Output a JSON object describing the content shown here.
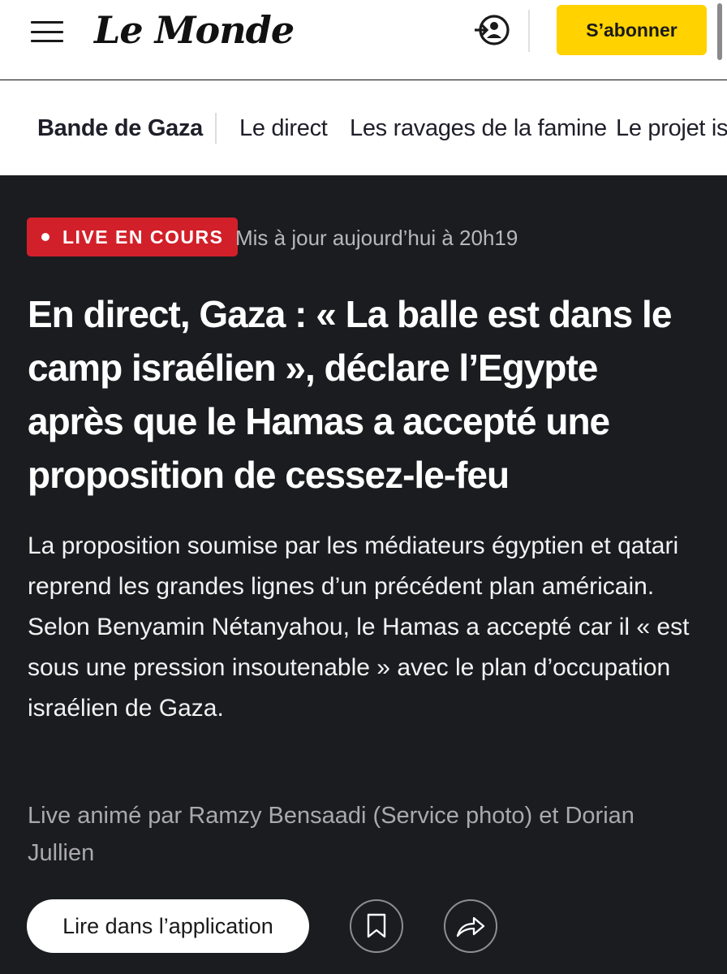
{
  "header": {
    "logo": "Le Monde",
    "subscribe_label": "S’abonner",
    "icons": [
      "menu-icon",
      "account-icon"
    ],
    "colors": {
      "subscribe_bg": "#ffd200"
    }
  },
  "subnav": {
    "section": "Bande de Gaza",
    "items": [
      "Le direct",
      "Les ravages de la famine",
      "Le projet is"
    ]
  },
  "article": {
    "live_label": "LIVE EN COURS",
    "updated": "Mis à jour aujourd’hui à 20h19",
    "headline": "En direct, Gaza : « La balle est dans le camp israélien », déclare l’Egypte après que le Hamas a accepté une proposition de cessez-le-feu",
    "lede": "La proposition soumise par les médiateurs égyptien et qatari reprend les grandes lignes d’un précédent plan américain. Selon Benyamin Nétanyahou, le Hamas a accepté car il « est sous une pression insoutenable » avec le plan d’occupation israélien de Gaza.",
    "byline": "Live animé par Ramzy Bensaadi (Service photo) et Dorian Jullien",
    "colors": {
      "live_badge": "#d2202a",
      "background": "#1b1c20"
    }
  },
  "actions": {
    "app_label": "Lire dans l’application",
    "icons": [
      "bookmark-icon",
      "share-icon"
    ]
  }
}
